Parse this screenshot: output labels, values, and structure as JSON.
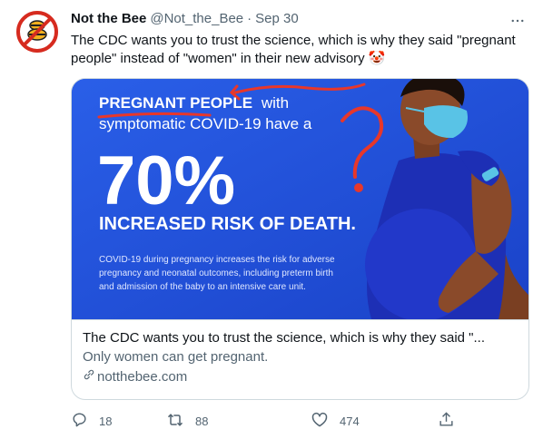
{
  "tweet": {
    "author": {
      "display_name": "Not the Bee",
      "handle": "@Not_the_Bee",
      "timestamp": "Sep 30",
      "separator": "·",
      "avatar_icon": "no-bees-logo-icon"
    },
    "text": "The CDC wants you to trust the science, which is why they said \"pregnant people\" instead of \"women\" in their new advisory",
    "emoji": "🤡",
    "more_icon": "more-options-icon"
  },
  "card": {
    "image": {
      "highlight": "PREGNANT PEOPLE",
      "line1_rest": "with",
      "line2": "symptomatic COVID-19 have a",
      "big_number": "70%",
      "headline": "INCREASED RISK OF DEATH.",
      "small_1": "COVID-19 during pregnancy increases the risk for adverse",
      "small_2": "pregnancy and neonatal outcomes, including preterm birth",
      "small_3": "and admission of the baby to an intensive care unit.",
      "colors": {
        "background": "#1e4fd8",
        "accent": "#e8372a",
        "mask": "#59c3e6",
        "dress": "#1d2fb5",
        "skin": "#8a4a2a"
      }
    },
    "title": "The CDC wants you to trust the science, which is why they said \"...",
    "description": "Only women can get pregnant.",
    "domain": "notthebee.com",
    "link_icon": "link-icon"
  },
  "actions": {
    "reply": {
      "icon": "reply-icon",
      "count": "18"
    },
    "retweet": {
      "icon": "retweet-icon",
      "count": "88"
    },
    "like": {
      "icon": "like-icon",
      "count": "474"
    },
    "share": {
      "icon": "share-icon"
    }
  }
}
